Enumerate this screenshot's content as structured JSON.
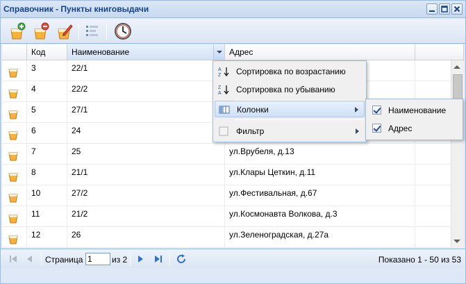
{
  "window": {
    "title": "Справочник - Пункты книговыдачи",
    "controls": [
      "minimize-icon",
      "maximize-icon",
      "close-icon"
    ]
  },
  "toolbar": {
    "buttons": [
      "add-icon",
      "delete-icon",
      "edit-icon",
      "list-icon",
      "clock-icon"
    ]
  },
  "grid": {
    "columns": [
      "Код",
      "Наименование",
      "Адрес"
    ],
    "rows": [
      {
        "code": "3",
        "name": "22/1",
        "address": ""
      },
      {
        "code": "4",
        "name": "22/2",
        "address": ""
      },
      {
        "code": "5",
        "name": "27/1",
        "address": ""
      },
      {
        "code": "6",
        "name": "24",
        "address": ""
      },
      {
        "code": "7",
        "name": "25",
        "address": "ул.Врубеля, д.13"
      },
      {
        "code": "8",
        "name": "21/1",
        "address": "ул.Клары Цеткин, д.11"
      },
      {
        "code": "10",
        "name": "27/2",
        "address": "ул.Фестивальная, д.67"
      },
      {
        "code": "11",
        "name": "21/2",
        "address": "ул.Космонавта Волкова, д.3"
      },
      {
        "code": "12",
        "name": "26",
        "address": "ул.Зеленоградская, д.27а"
      }
    ]
  },
  "column_menu": {
    "items": [
      {
        "label": "Сортировка по возрастанию",
        "icon": "sort-ascending-icon"
      },
      {
        "label": "Сортировка по убыванию",
        "icon": "sort-descending-icon"
      },
      {
        "label": "Колонки",
        "icon": "columns-icon"
      },
      {
        "label": "Фильтр",
        "icon": "filter-checkbox-icon"
      }
    ],
    "columns_submenu": [
      {
        "label": "Наименование",
        "checked": true
      },
      {
        "label": "Адрес",
        "checked": true
      }
    ]
  },
  "pager": {
    "page_label": "Страница",
    "page_value": "1",
    "of_label": "из 2",
    "display": "Показано 1 - 50 из 53"
  },
  "colors": {
    "title": "#15428b",
    "border": "#99bbe8",
    "menu_highlight": "#cfe0f7"
  }
}
